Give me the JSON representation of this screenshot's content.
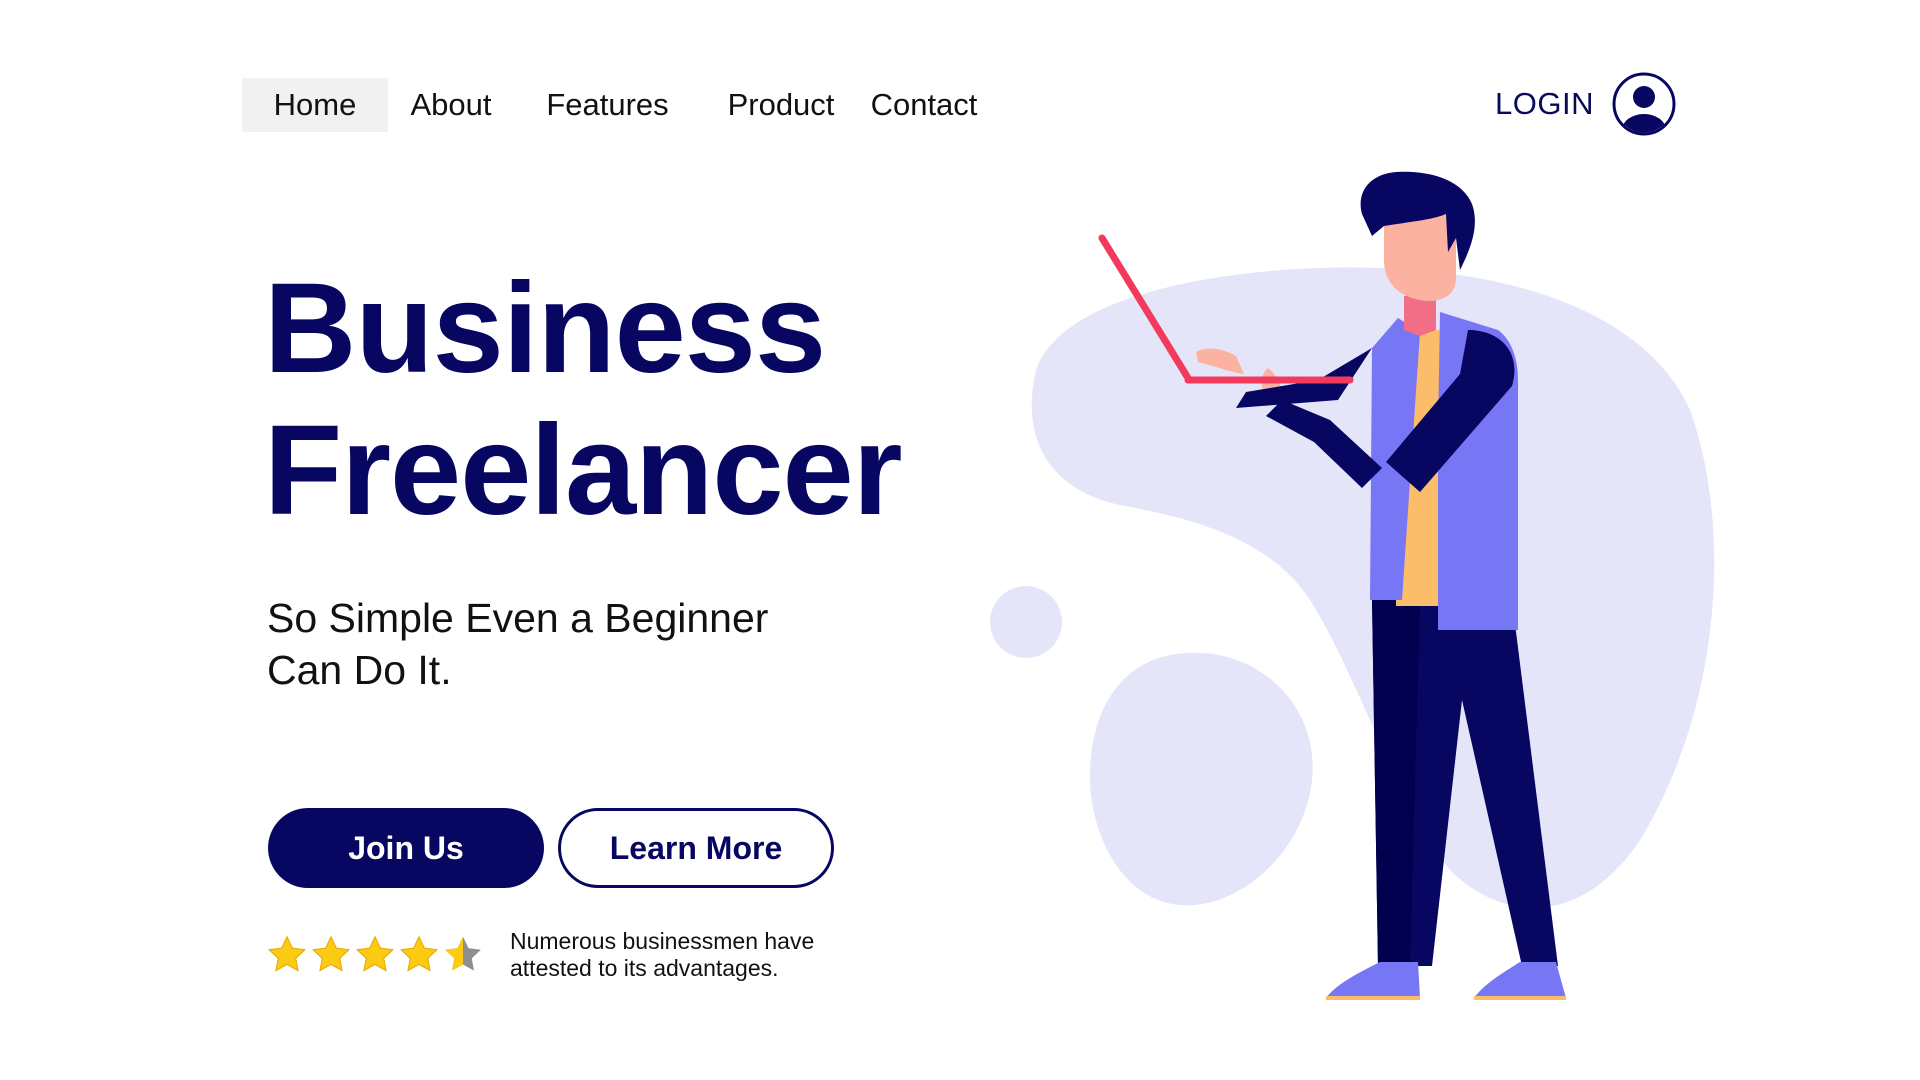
{
  "nav": {
    "items": [
      {
        "label": "Home"
      },
      {
        "label": "About"
      },
      {
        "label": "Features"
      },
      {
        "label": "Product"
      },
      {
        "label": "Contact"
      }
    ],
    "active_item": "Home"
  },
  "login": {
    "label": "LOGIN",
    "icon": "user-circle-icon"
  },
  "hero": {
    "title_line1": "Business",
    "title_line2": "Freelancer",
    "subtitle_line1": "So Simple Even a Beginner",
    "subtitle_line2": "Can Do It."
  },
  "buttons": {
    "join_label": "Join Us",
    "learn_label": "Learn More"
  },
  "rating": {
    "stars_out_of_5": 4.5,
    "text_line1": "Numerous businessmen have",
    "text_line2": "attested to its advantages."
  },
  "colors": {
    "primary": "#070762",
    "blob": "#e5e5fa",
    "star": "#fbcb14",
    "laptop": "#f23a5c",
    "vest": "#7777f5",
    "shirt": "#fcbd6a"
  }
}
